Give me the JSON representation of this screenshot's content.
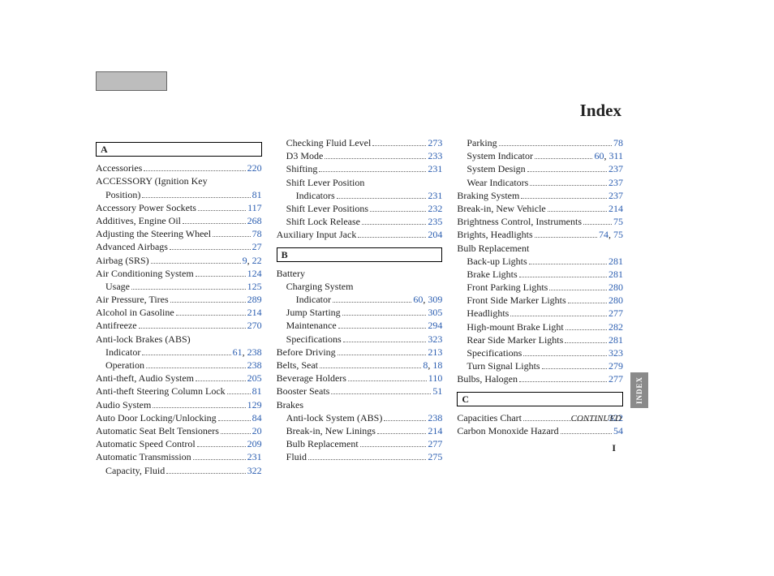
{
  "title": "Index",
  "side_tab": "INDEX",
  "continued": "CONTINUED",
  "page_num": "I",
  "columns": [
    [
      {
        "type": "header",
        "text": "A"
      },
      {
        "label": "Accessories",
        "pages": [
          "220"
        ]
      },
      {
        "label": "ACCESSORY (Ignition Key",
        "noline": true
      },
      {
        "label": "Position)",
        "pages": [
          "81"
        ],
        "indent": 1
      },
      {
        "label": "Accessory Power Sockets",
        "pages": [
          "117"
        ]
      },
      {
        "label": "Additives, Engine Oil",
        "pages": [
          "268"
        ]
      },
      {
        "label": "Adjusting the Steering Wheel",
        "pages": [
          "78"
        ]
      },
      {
        "label": "Advanced Airbags",
        "pages": [
          "27"
        ]
      },
      {
        "label": "Airbag (SRS)",
        "pages": [
          "9",
          "22"
        ]
      },
      {
        "label": "Air Conditioning System",
        "pages": [
          "124"
        ]
      },
      {
        "label": "Usage",
        "pages": [
          "125"
        ],
        "indent": 1
      },
      {
        "label": "Air Pressure, Tires",
        "pages": [
          "289"
        ]
      },
      {
        "label": "Alcohol in Gasoline",
        "pages": [
          "214"
        ]
      },
      {
        "label": "Antifreeze",
        "pages": [
          "270"
        ]
      },
      {
        "label": "Anti-lock Brakes (ABS)",
        "noline": true
      },
      {
        "label": "Indicator",
        "pages": [
          "61",
          "238"
        ],
        "indent": 1
      },
      {
        "label": "Operation",
        "pages": [
          "238"
        ],
        "indent": 1
      },
      {
        "label": "Anti-theft, Audio System",
        "pages": [
          "205"
        ]
      },
      {
        "label": "Anti-theft Steering Column Lock",
        "pages": [
          "81"
        ]
      },
      {
        "label": "Audio System",
        "pages": [
          "129"
        ]
      },
      {
        "label": "Auto Door Locking/Unlocking",
        "pages": [
          "84"
        ]
      },
      {
        "label": "Automatic Seat Belt Tensioners",
        "pages": [
          "20"
        ]
      },
      {
        "label": "Automatic Speed Control",
        "pages": [
          "209"
        ]
      },
      {
        "label": "Automatic Transmission",
        "pages": [
          "231"
        ]
      },
      {
        "label": "Capacity, Fluid",
        "pages": [
          "322"
        ],
        "indent": 1
      }
    ],
    [
      {
        "label": "Checking Fluid Level",
        "pages": [
          "273"
        ],
        "indent": 1
      },
      {
        "label": "D3 Mode",
        "pages": [
          "233"
        ],
        "indent": 1
      },
      {
        "label": "Shifting",
        "pages": [
          "231"
        ],
        "indent": 1
      },
      {
        "label": "Shift Lever Position",
        "noline": true,
        "indent": 1
      },
      {
        "label": "Indicators",
        "pages": [
          "231"
        ],
        "indent": 2
      },
      {
        "label": "Shift Lever Positions",
        "pages": [
          "232"
        ],
        "indent": 1
      },
      {
        "label": "Shift Lock Release",
        "pages": [
          "235"
        ],
        "indent": 1
      },
      {
        "label": "Auxiliary Input Jack",
        "pages": [
          "204"
        ]
      },
      {
        "type": "header",
        "text": "B"
      },
      {
        "label": "Battery",
        "noline": true
      },
      {
        "label": "Charging System",
        "noline": true,
        "indent": 1
      },
      {
        "label": "Indicator",
        "pages": [
          "60",
          "309"
        ],
        "indent": 2
      },
      {
        "label": "Jump Starting",
        "pages": [
          "305"
        ],
        "indent": 1
      },
      {
        "label": "Maintenance",
        "pages": [
          "294"
        ],
        "indent": 1
      },
      {
        "label": "Specifications",
        "pages": [
          "323"
        ],
        "indent": 1
      },
      {
        "label": "Before Driving",
        "pages": [
          "213"
        ]
      },
      {
        "label": "Belts, Seat",
        "pages": [
          "8",
          "18"
        ]
      },
      {
        "label": "Beverage Holders",
        "pages": [
          "110"
        ]
      },
      {
        "label": "Booster Seats",
        "pages": [
          "51"
        ]
      },
      {
        "label": "Brakes",
        "noline": true
      },
      {
        "label": "Anti-lock System (ABS)",
        "pages": [
          "238"
        ],
        "indent": 1
      },
      {
        "label": "Break-in, New Linings",
        "pages": [
          "214"
        ],
        "indent": 1
      },
      {
        "label": "Bulb Replacement",
        "pages": [
          "277"
        ],
        "indent": 1
      },
      {
        "label": "Fluid",
        "pages": [
          "275"
        ],
        "indent": 1
      }
    ],
    [
      {
        "label": "Parking",
        "pages": [
          "78"
        ],
        "indent": 1
      },
      {
        "label": "System Indicator",
        "pages": [
          "60",
          "311"
        ],
        "indent": 1
      },
      {
        "label": "System Design",
        "pages": [
          "237"
        ],
        "indent": 1
      },
      {
        "label": "Wear Indicators",
        "pages": [
          "237"
        ],
        "indent": 1
      },
      {
        "label": "Braking System",
        "pages": [
          "237"
        ]
      },
      {
        "label": "Break-in, New Vehicle",
        "pages": [
          "214"
        ]
      },
      {
        "label": "Brightness Control, Instruments",
        "pages": [
          "75"
        ]
      },
      {
        "label": "Brights, Headlights",
        "pages": [
          "74",
          "75"
        ]
      },
      {
        "label": "Bulb Replacement",
        "noline": true
      },
      {
        "label": "Back-up Lights",
        "pages": [
          "281"
        ],
        "indent": 1
      },
      {
        "label": "Brake Lights",
        "pages": [
          "281"
        ],
        "indent": 1
      },
      {
        "label": "Front Parking Lights",
        "pages": [
          "280"
        ],
        "indent": 1
      },
      {
        "label": "Front Side Marker Lights",
        "pages": [
          "280"
        ],
        "indent": 1
      },
      {
        "label": "Headlights",
        "pages": [
          "277"
        ],
        "indent": 1
      },
      {
        "label": "High-mount Brake Light",
        "pages": [
          "282"
        ],
        "indent": 1
      },
      {
        "label": "Rear Side Marker Lights",
        "pages": [
          "281"
        ],
        "indent": 1
      },
      {
        "label": "Specifications",
        "pages": [
          "323"
        ],
        "indent": 1
      },
      {
        "label": "Turn Signal Lights",
        "pages": [
          "279"
        ],
        "indent": 1
      },
      {
        "label": "Bulbs, Halogen",
        "pages": [
          "277"
        ]
      },
      {
        "type": "header",
        "text": "C"
      },
      {
        "label": "Capacities Chart",
        "pages": [
          "322"
        ]
      },
      {
        "label": "Carbon Monoxide Hazard",
        "pages": [
          "54"
        ]
      }
    ]
  ]
}
